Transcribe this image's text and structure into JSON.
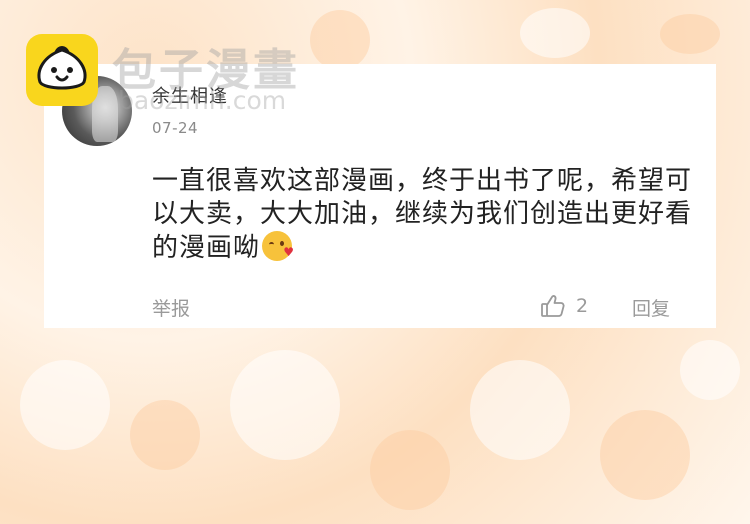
{
  "watermark": {
    "title": "包子漫畫",
    "url": "baozimh.com"
  },
  "comment": {
    "username": "余生相逢",
    "date": "07-24",
    "text": "一直很喜欢这部漫画，终于出书了呢，希望可以大卖，大大加油，继续为我们创造出更好看的漫画呦",
    "emoji": "kiss-heart-emoji",
    "report_label": "举报",
    "like_count": "2",
    "reply_label": "回复"
  },
  "colors": {
    "card_bg": "#ffffff",
    "text_primary": "#222222",
    "text_secondary": "#9a9a9a",
    "logo_yellow": "#f9d61d"
  }
}
